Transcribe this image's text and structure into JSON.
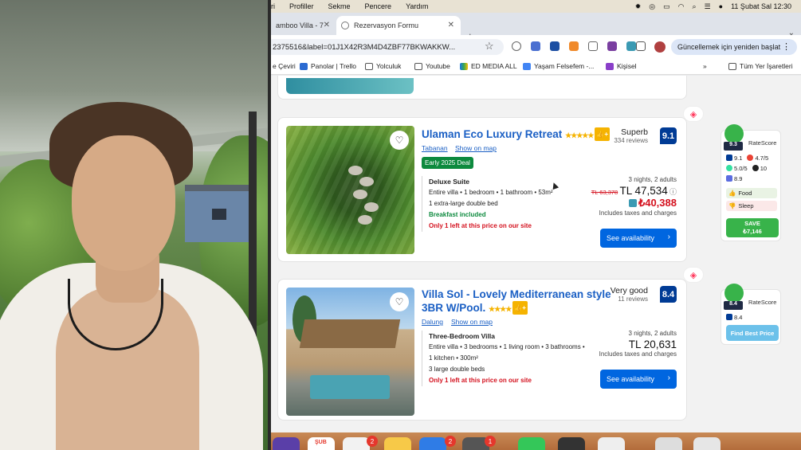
{
  "menubar": {
    "items": [
      "ri",
      "Profiller",
      "Sekme",
      "Pencere",
      "Yardım"
    ],
    "datetime": "11 Şubat Sal  12:30"
  },
  "tabs": [
    {
      "label": "amboo Villa - 7"
    },
    {
      "label": "Rezervasyon Formu"
    }
  ],
  "address": {
    "url": "2375516&label=01J1X42R3M4D4ZBF77BKWAKKW...",
    "update_label": "Güncellemek için yeniden başlat"
  },
  "bookmarks": [
    "e Çeviri",
    "Panolar | Trello",
    "Yolculuk",
    "Youtube",
    "ED MEDIA ALL",
    "Yaşam Felsefem -...",
    "Kişisel",
    "Tüm Yer İşaretleri"
  ],
  "listings": [
    {
      "title": "Ulaman Eco Luxury Retreat",
      "stars": "★★★★★",
      "location": "Tabanan",
      "show_map": "Show on map",
      "deal": "Early 2025 Deal",
      "room_type": "Deluxe Suite",
      "room_desc": "Entire villa • 1 bedroom • 1 bathroom • 53m²",
      "bed": "1 extra-large double bed",
      "breakfast": "Breakfast included",
      "scarcity": "Only 1 left at this price on our site",
      "score_word": "Superb",
      "reviews": "334 reviews",
      "score": "9.1",
      "stay": "3 nights, 2 adults",
      "old_price": "TL 63,378",
      "price": "TL 47,534",
      "alt_price": "₺40,388",
      "taxes": "Includes taxes and charges",
      "cta": "See availability"
    },
    {
      "title_line1": "Villa Sol - Lovely Mediterranean style",
      "title_line2": "3BR W/Pool.",
      "stars": "★★★★",
      "location": "Dalung",
      "show_map": "Show on map",
      "room_type": "Three-Bedroom Villa",
      "room_desc": "Entire villa • 3 bedrooms • 1 living room • 3 bathrooms •",
      "room_desc2": "1 kitchen • 300m²",
      "bed": "3 large double beds",
      "scarcity": "Only 1 left at this price on our site",
      "score_word": "Very good",
      "reviews": "11 reviews",
      "score": "8.4",
      "stay": "3 nights, 2 adults",
      "price": "TL 20,631",
      "taxes": "Includes taxes and charges",
      "cta": "See availability"
    }
  ],
  "ratescore": [
    {
      "label": "RateScore",
      "score": "9.3",
      "booking": "9.1",
      "google": "4.7/5",
      "trip": "5.0/5",
      "other": "10",
      "extra": "8.9",
      "food": "Food",
      "sleep": "Sleep",
      "save_label": "SAVE",
      "save_amount": "₺7,146"
    },
    {
      "label": "RateScore",
      "score": "8.4",
      "booking": "8.4",
      "cta": "Find Best Price"
    }
  ],
  "dock": {
    "date": "ŞUB",
    "badges": [
      "2",
      "2",
      "1"
    ]
  },
  "colors": {
    "link": "#1a5fc4",
    "brand_blue": "#003b95",
    "cta_blue": "#0066e0",
    "deal_green": "#0d8a3e",
    "alert_red": "#d4111e"
  }
}
